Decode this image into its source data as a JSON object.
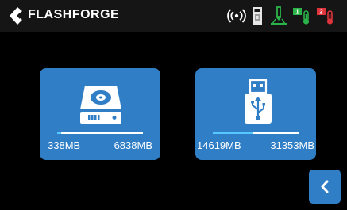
{
  "header": {
    "brand": "FLASHFORGE",
    "logo_icon": "flashforge-logo-icon",
    "status_icons": [
      "wifi-icon",
      "sd-card-icon",
      "nozzle-temp-icon",
      "extruder1-temp-icon",
      "extruder2-temp-icon"
    ]
  },
  "storage": {
    "internal": {
      "icon": "hard-drive-icon",
      "used": "338MB",
      "total": "6838MB",
      "used_fraction": 0.05
    },
    "usb": {
      "icon": "usb-drive-icon",
      "used": "14619MB",
      "total": "31353MB",
      "used_fraction": 0.47
    }
  },
  "back_button": {
    "icon": "chevron-left-icon"
  },
  "colors": {
    "accent": "#2f7ec6",
    "progress": "#55c8ff",
    "topbar": "#151515",
    "status_green": "#2bb34a",
    "status_red": "#e0343c"
  }
}
